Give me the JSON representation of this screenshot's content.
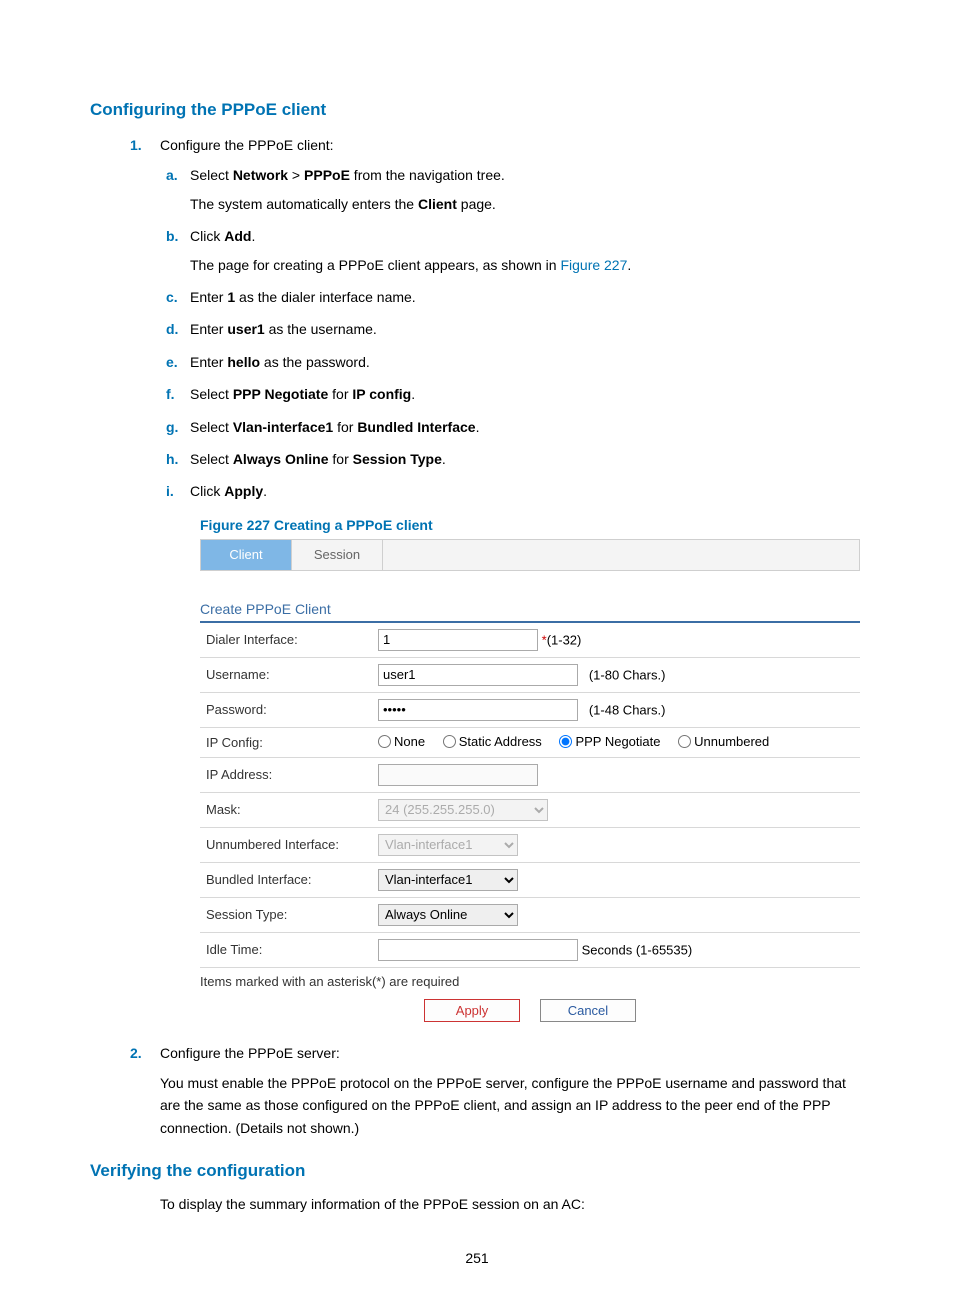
{
  "heading1": "Configuring the PPPoE client",
  "step1": {
    "num": "1.",
    "text": "Configure the PPPoE client:",
    "sub": {
      "a": {
        "marker": "a.",
        "pre": "Select ",
        "b1": "Network",
        "sep": " > ",
        "b2": "PPPoE",
        "post": " from the navigation tree.",
        "line2a": "The system automatically enters the ",
        "line2b": "Client",
        "line2c": " page."
      },
      "b": {
        "marker": "b.",
        "pre": "Click ",
        "bold": "Add",
        "post": ".",
        "line2a": "The page for creating a PPPoE client appears, as shown in ",
        "link": "Figure 227",
        "line2b": "."
      },
      "c": {
        "marker": "c.",
        "pre": "Enter ",
        "bold": "1",
        "post": " as the dialer interface name."
      },
      "d": {
        "marker": "d.",
        "pre": "Enter ",
        "bold": "user1",
        "post": " as the username."
      },
      "e": {
        "marker": "e.",
        "pre": "Enter ",
        "bold": "hello",
        "post": " as the password."
      },
      "f": {
        "marker": "f.",
        "pre": "Select ",
        "b1": "PPP Negotiate",
        "mid": " for ",
        "b2": "IP config",
        "post": "."
      },
      "g": {
        "marker": "g.",
        "pre": "Select ",
        "b1": "Vlan-interface1",
        "mid": " for ",
        "b2": "Bundled Interface",
        "post": "."
      },
      "h": {
        "marker": "h.",
        "pre": "Select ",
        "b1": "Always Online",
        "mid": " for ",
        "b2": "Session Type",
        "post": "."
      },
      "i": {
        "marker": "i.",
        "pre": "Click ",
        "bold": "Apply",
        "post": "."
      }
    }
  },
  "figure_caption": "Figure 227 Creating a PPPoE client",
  "shot": {
    "tabs": {
      "client": "Client",
      "session": "Session"
    },
    "panel_title": "Create PPPoE Client",
    "labels": {
      "dialer": "Dialer Interface:",
      "username": "Username:",
      "password": "Password:",
      "ipconfig": "IP Config:",
      "ipaddress": "IP Address:",
      "mask": "Mask:",
      "unnum_if": "Unnumbered Interface:",
      "bundled_if": "Bundled Interface:",
      "session_type": "Session Type:",
      "idle_time": "Idle Time:"
    },
    "values": {
      "dialer": "1",
      "dialer_hint_star": "*",
      "dialer_hint": "(1-32)",
      "username": "user1",
      "username_hint": "(1-80 Chars.)",
      "password": "•••••",
      "password_hint": "(1-48 Chars.)",
      "radio_none": "None",
      "radio_static": "Static Address",
      "radio_ppp": "PPP Negotiate",
      "radio_unnum": "Unnumbered",
      "ipaddress": "",
      "mask": "24 (255.255.255.0)",
      "unnum_if": "Vlan-interface1",
      "bundled_if": "Vlan-interface1",
      "session_type": "Always Online",
      "idle_time": "",
      "idle_time_hint": "Seconds (1-65535)"
    },
    "req_note": "Items marked with an asterisk(*) are required",
    "buttons": {
      "apply": "Apply",
      "cancel": "Cancel"
    }
  },
  "step2": {
    "num": "2.",
    "text": "Configure the PPPoE server:",
    "para": "You must enable the PPPoE protocol on the PPPoE server, configure the PPPoE username and password that are the same as those configured on the PPPoE client, and assign an IP address to the peer end of the PPP connection. (Details not shown.)"
  },
  "heading2": "Verifying the configuration",
  "verify_para": "To display the summary information of the PPPoE session on an AC:",
  "page_num": "251"
}
